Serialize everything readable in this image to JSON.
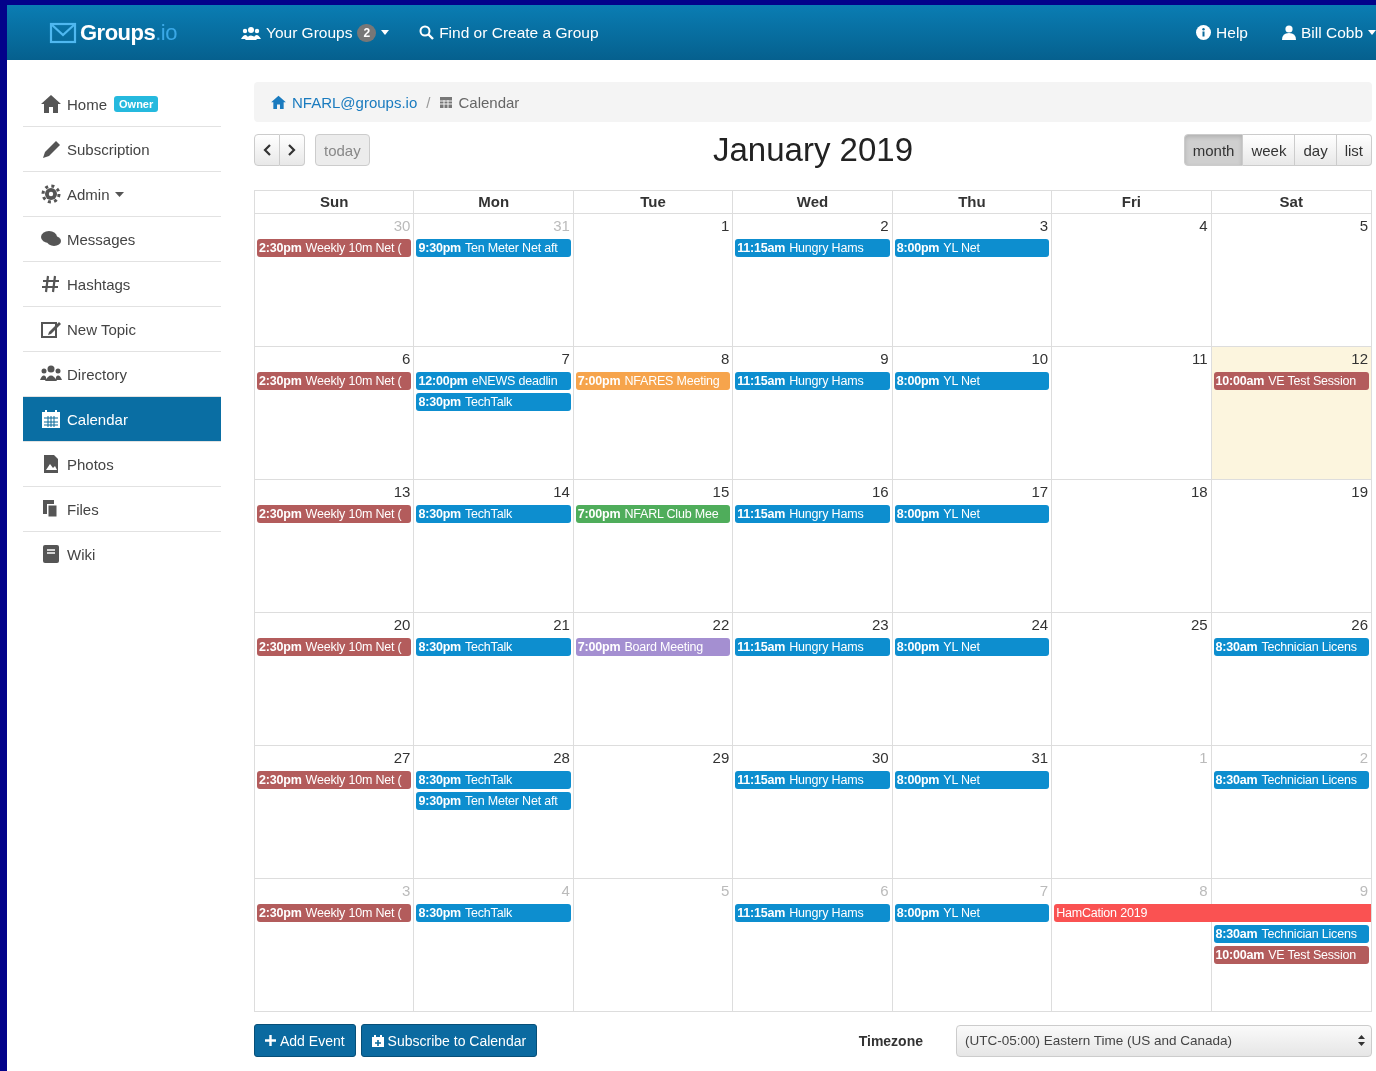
{
  "topbar": {
    "logo": {
      "name": "Groups",
      "suffix": ".io"
    },
    "nav": [
      {
        "label": "Your Groups",
        "badge": "2",
        "dropdown": true
      },
      {
        "label": "Find or Create a Group",
        "dropdown": false
      }
    ],
    "right": [
      {
        "label": "Help",
        "dropdown": false
      },
      {
        "label": "Bill Cobb",
        "dropdown": true
      }
    ]
  },
  "sidebar": {
    "items": [
      {
        "label": "Home",
        "badge": "Owner",
        "dropdown": false,
        "selected": false
      },
      {
        "label": "Subscription",
        "dropdown": false,
        "selected": false
      },
      {
        "label": "Admin",
        "dropdown": true,
        "selected": false
      },
      {
        "label": "Messages",
        "dropdown": false,
        "selected": false
      },
      {
        "label": "Hashtags",
        "dropdown": false,
        "selected": false
      },
      {
        "label": "New Topic",
        "dropdown": false,
        "selected": false
      },
      {
        "label": "Directory",
        "dropdown": false,
        "selected": false
      },
      {
        "label": "Calendar",
        "dropdown": false,
        "selected": true
      },
      {
        "label": "Photos",
        "dropdown": false,
        "selected": false
      },
      {
        "label": "Files",
        "dropdown": false,
        "selected": false
      },
      {
        "label": "Wiki",
        "dropdown": false,
        "selected": false
      }
    ]
  },
  "breadcrumb": {
    "group": "NFARL@groups.io",
    "separator": "/",
    "page": "Calendar"
  },
  "toolbar": {
    "today": "today",
    "title": "January 2019",
    "views": [
      {
        "label": "month",
        "selected": true
      },
      {
        "label": "week",
        "selected": false
      },
      {
        "label": "day",
        "selected": false
      },
      {
        "label": "list",
        "selected": false
      }
    ]
  },
  "calendar": {
    "weekdays": [
      "Sun",
      "Mon",
      "Tue",
      "Wed",
      "Thu",
      "Fri",
      "Sat"
    ],
    "weeks": [
      {
        "days": [
          {
            "number": "30",
            "other_month": true,
            "today": false,
            "events": [
              {
                "time": "2:30pm",
                "title": "Weekly 10m Net (",
                "color": "#b35c5c",
                "continues": false
              }
            ]
          },
          {
            "number": "31",
            "other_month": true,
            "today": false,
            "events": [
              {
                "time": "9:30pm",
                "title": "Ten Meter Net aft",
                "color": "#0d8ecf",
                "continues": false
              }
            ]
          },
          {
            "number": "1",
            "other_month": false,
            "today": false
          },
          {
            "number": "2",
            "other_month": false,
            "today": false,
            "events": [
              {
                "time": "11:15am",
                "title": "Hungry Hams",
                "color": "#0d8ecf",
                "continues": false
              }
            ]
          },
          {
            "number": "3",
            "other_month": false,
            "today": false,
            "events": [
              {
                "time": "8:00pm",
                "title": "YL Net",
                "color": "#0d8ecf",
                "continues": false
              }
            ]
          },
          {
            "number": "4",
            "other_month": false,
            "today": false
          },
          {
            "number": "5",
            "other_month": false,
            "today": false
          }
        ]
      },
      {
        "days": [
          {
            "number": "6",
            "other_month": false,
            "today": false,
            "events": [
              {
                "time": "2:30pm",
                "title": "Weekly 10m Net (",
                "color": "#b35c5c",
                "continues": false
              }
            ]
          },
          {
            "number": "7",
            "other_month": false,
            "today": false,
            "events": [
              {
                "time": "12:00pm",
                "title": "eNEWS deadlin",
                "color": "#0d8ecf",
                "continues": false
              },
              {
                "time": "8:30pm",
                "title": "TechTalk",
                "color": "#0d8ecf",
                "continues": false
              }
            ]
          },
          {
            "number": "8",
            "other_month": false,
            "today": false,
            "events": [
              {
                "time": "7:00pm",
                "title": "NFARES Meeting",
                "color": "#f6a44c",
                "continues": false
              }
            ]
          },
          {
            "number": "9",
            "other_month": false,
            "today": false,
            "events": [
              {
                "time": "11:15am",
                "title": "Hungry Hams",
                "color": "#0d8ecf",
                "continues": false
              }
            ]
          },
          {
            "number": "10",
            "other_month": false,
            "today": false,
            "events": [
              {
                "time": "8:00pm",
                "title": "YL Net",
                "color": "#0d8ecf",
                "continues": false
              }
            ]
          },
          {
            "number": "11",
            "other_month": false,
            "today": false
          },
          {
            "number": "12",
            "other_month": false,
            "today": true,
            "events": [
              {
                "time": "10:00am",
                "title": "VE Test Session",
                "color": "#b35c5c",
                "continues": false
              }
            ]
          }
        ]
      },
      {
        "days": [
          {
            "number": "13",
            "other_month": false,
            "today": false,
            "events": [
              {
                "time": "2:30pm",
                "title": "Weekly 10m Net (",
                "color": "#b35c5c",
                "continues": false
              }
            ]
          },
          {
            "number": "14",
            "other_month": false,
            "today": false,
            "events": [
              {
                "time": "8:30pm",
                "title": "TechTalk",
                "color": "#0d8ecf",
                "continues": false
              }
            ]
          },
          {
            "number": "15",
            "other_month": false,
            "today": false,
            "events": [
              {
                "time": "7:00pm",
                "title": "NFARL Club Mee",
                "color": "#4fad5b",
                "continues": false
              }
            ]
          },
          {
            "number": "16",
            "other_month": false,
            "today": false,
            "events": [
              {
                "time": "11:15am",
                "title": "Hungry Hams",
                "color": "#0d8ecf",
                "continues": false
              }
            ]
          },
          {
            "number": "17",
            "other_month": false,
            "today": false,
            "events": [
              {
                "time": "8:00pm",
                "title": "YL Net",
                "color": "#0d8ecf",
                "continues": false
              }
            ]
          },
          {
            "number": "18",
            "other_month": false,
            "today": false
          },
          {
            "number": "19",
            "other_month": false,
            "today": false
          }
        ]
      },
      {
        "days": [
          {
            "number": "20",
            "other_month": false,
            "today": false,
            "events": [
              {
                "time": "2:30pm",
                "title": "Weekly 10m Net (",
                "color": "#b35c5c",
                "continues": false
              }
            ]
          },
          {
            "number": "21",
            "other_month": false,
            "today": false,
            "events": [
              {
                "time": "8:30pm",
                "title": "TechTalk",
                "color": "#0d8ecf",
                "continues": false
              }
            ]
          },
          {
            "number": "22",
            "other_month": false,
            "today": false,
            "events": [
              {
                "time": "7:00pm",
                "title": "Board Meeting",
                "color": "#a48fd1",
                "continues": false
              }
            ]
          },
          {
            "number": "23",
            "other_month": false,
            "today": false,
            "events": [
              {
                "time": "11:15am",
                "title": "Hungry Hams",
                "color": "#0d8ecf",
                "continues": false
              }
            ]
          },
          {
            "number": "24",
            "other_month": false,
            "today": false,
            "events": [
              {
                "time": "8:00pm",
                "title": "YL Net",
                "color": "#0d8ecf",
                "continues": false
              }
            ]
          },
          {
            "number": "25",
            "other_month": false,
            "today": false
          },
          {
            "number": "26",
            "other_month": false,
            "today": false,
            "events": [
              {
                "time": "8:30am",
                "title": "Technician Licens",
                "color": "#0d8ecf",
                "continues": false
              }
            ]
          }
        ]
      },
      {
        "days": [
          {
            "number": "27",
            "other_month": false,
            "today": false,
            "events": [
              {
                "time": "2:30pm",
                "title": "Weekly 10m Net (",
                "color": "#b35c5c",
                "continues": false
              }
            ]
          },
          {
            "number": "28",
            "other_month": false,
            "today": false,
            "events": [
              {
                "time": "8:30pm",
                "title": "TechTalk",
                "color": "#0d8ecf",
                "continues": false
              },
              {
                "time": "9:30pm",
                "title": "Ten Meter Net aft",
                "color": "#0d8ecf",
                "continues": false
              }
            ]
          },
          {
            "number": "29",
            "other_month": false,
            "today": false
          },
          {
            "number": "30",
            "other_month": false,
            "today": false,
            "events": [
              {
                "time": "11:15am",
                "title": "Hungry Hams",
                "color": "#0d8ecf",
                "continues": false
              }
            ]
          },
          {
            "number": "31",
            "other_month": false,
            "today": false,
            "events": [
              {
                "time": "8:00pm",
                "title": "YL Net",
                "color": "#0d8ecf",
                "continues": false
              }
            ]
          },
          {
            "number": "1",
            "other_month": true,
            "today": false
          },
          {
            "number": "2",
            "other_month": true,
            "today": false,
            "events": [
              {
                "time": "8:30am",
                "title": "Technician Licens",
                "color": "#0d8ecf",
                "continues": false
              }
            ]
          }
        ]
      },
      {
        "days": [
          {
            "number": "3",
            "other_month": true,
            "today": false,
            "events": [
              {
                "time": "2:30pm",
                "title": "Weekly 10m Net (",
                "color": "#b35c5c",
                "continues": false
              }
            ]
          },
          {
            "number": "4",
            "other_month": true,
            "today": false,
            "events": [
              {
                "time": "8:30pm",
                "title": "TechTalk",
                "color": "#0d8ecf",
                "continues": false
              }
            ]
          },
          {
            "number": "5",
            "other_month": true,
            "today": false
          },
          {
            "number": "6",
            "other_month": true,
            "today": false,
            "events": [
              {
                "time": "11:15am",
                "title": "Hungry Hams",
                "color": "#0d8ecf",
                "continues": false
              }
            ]
          },
          {
            "number": "7",
            "other_month": true,
            "today": false,
            "events": [
              {
                "time": "8:00pm",
                "title": "YL Net",
                "color": "#0d8ecf",
                "continues": false
              }
            ]
          },
          {
            "number": "8",
            "other_month": true,
            "today": false,
            "events": [
              {
                "title": "HamCation 2019",
                "color": "#fa5252",
                "continues": true
              }
            ]
          },
          {
            "number": "9",
            "other_month": true,
            "today": false,
            "events": [
              {
                "time": "8:30am",
                "title": "Technician Licens",
                "color": "#0d8ecf",
                "continues": false
              },
              {
                "time": "10:00am",
                "title": "VE Test Session",
                "color": "#b35c5c",
                "continues": false
              }
            ]
          }
        ]
      }
    ]
  },
  "footer": {
    "buttons": [
      "Add Event",
      "Subscribe to Calendar"
    ],
    "timezone_label": "Timezone",
    "timezone": "(UTC-05:00) Eastern Time (US and Canada)"
  }
}
